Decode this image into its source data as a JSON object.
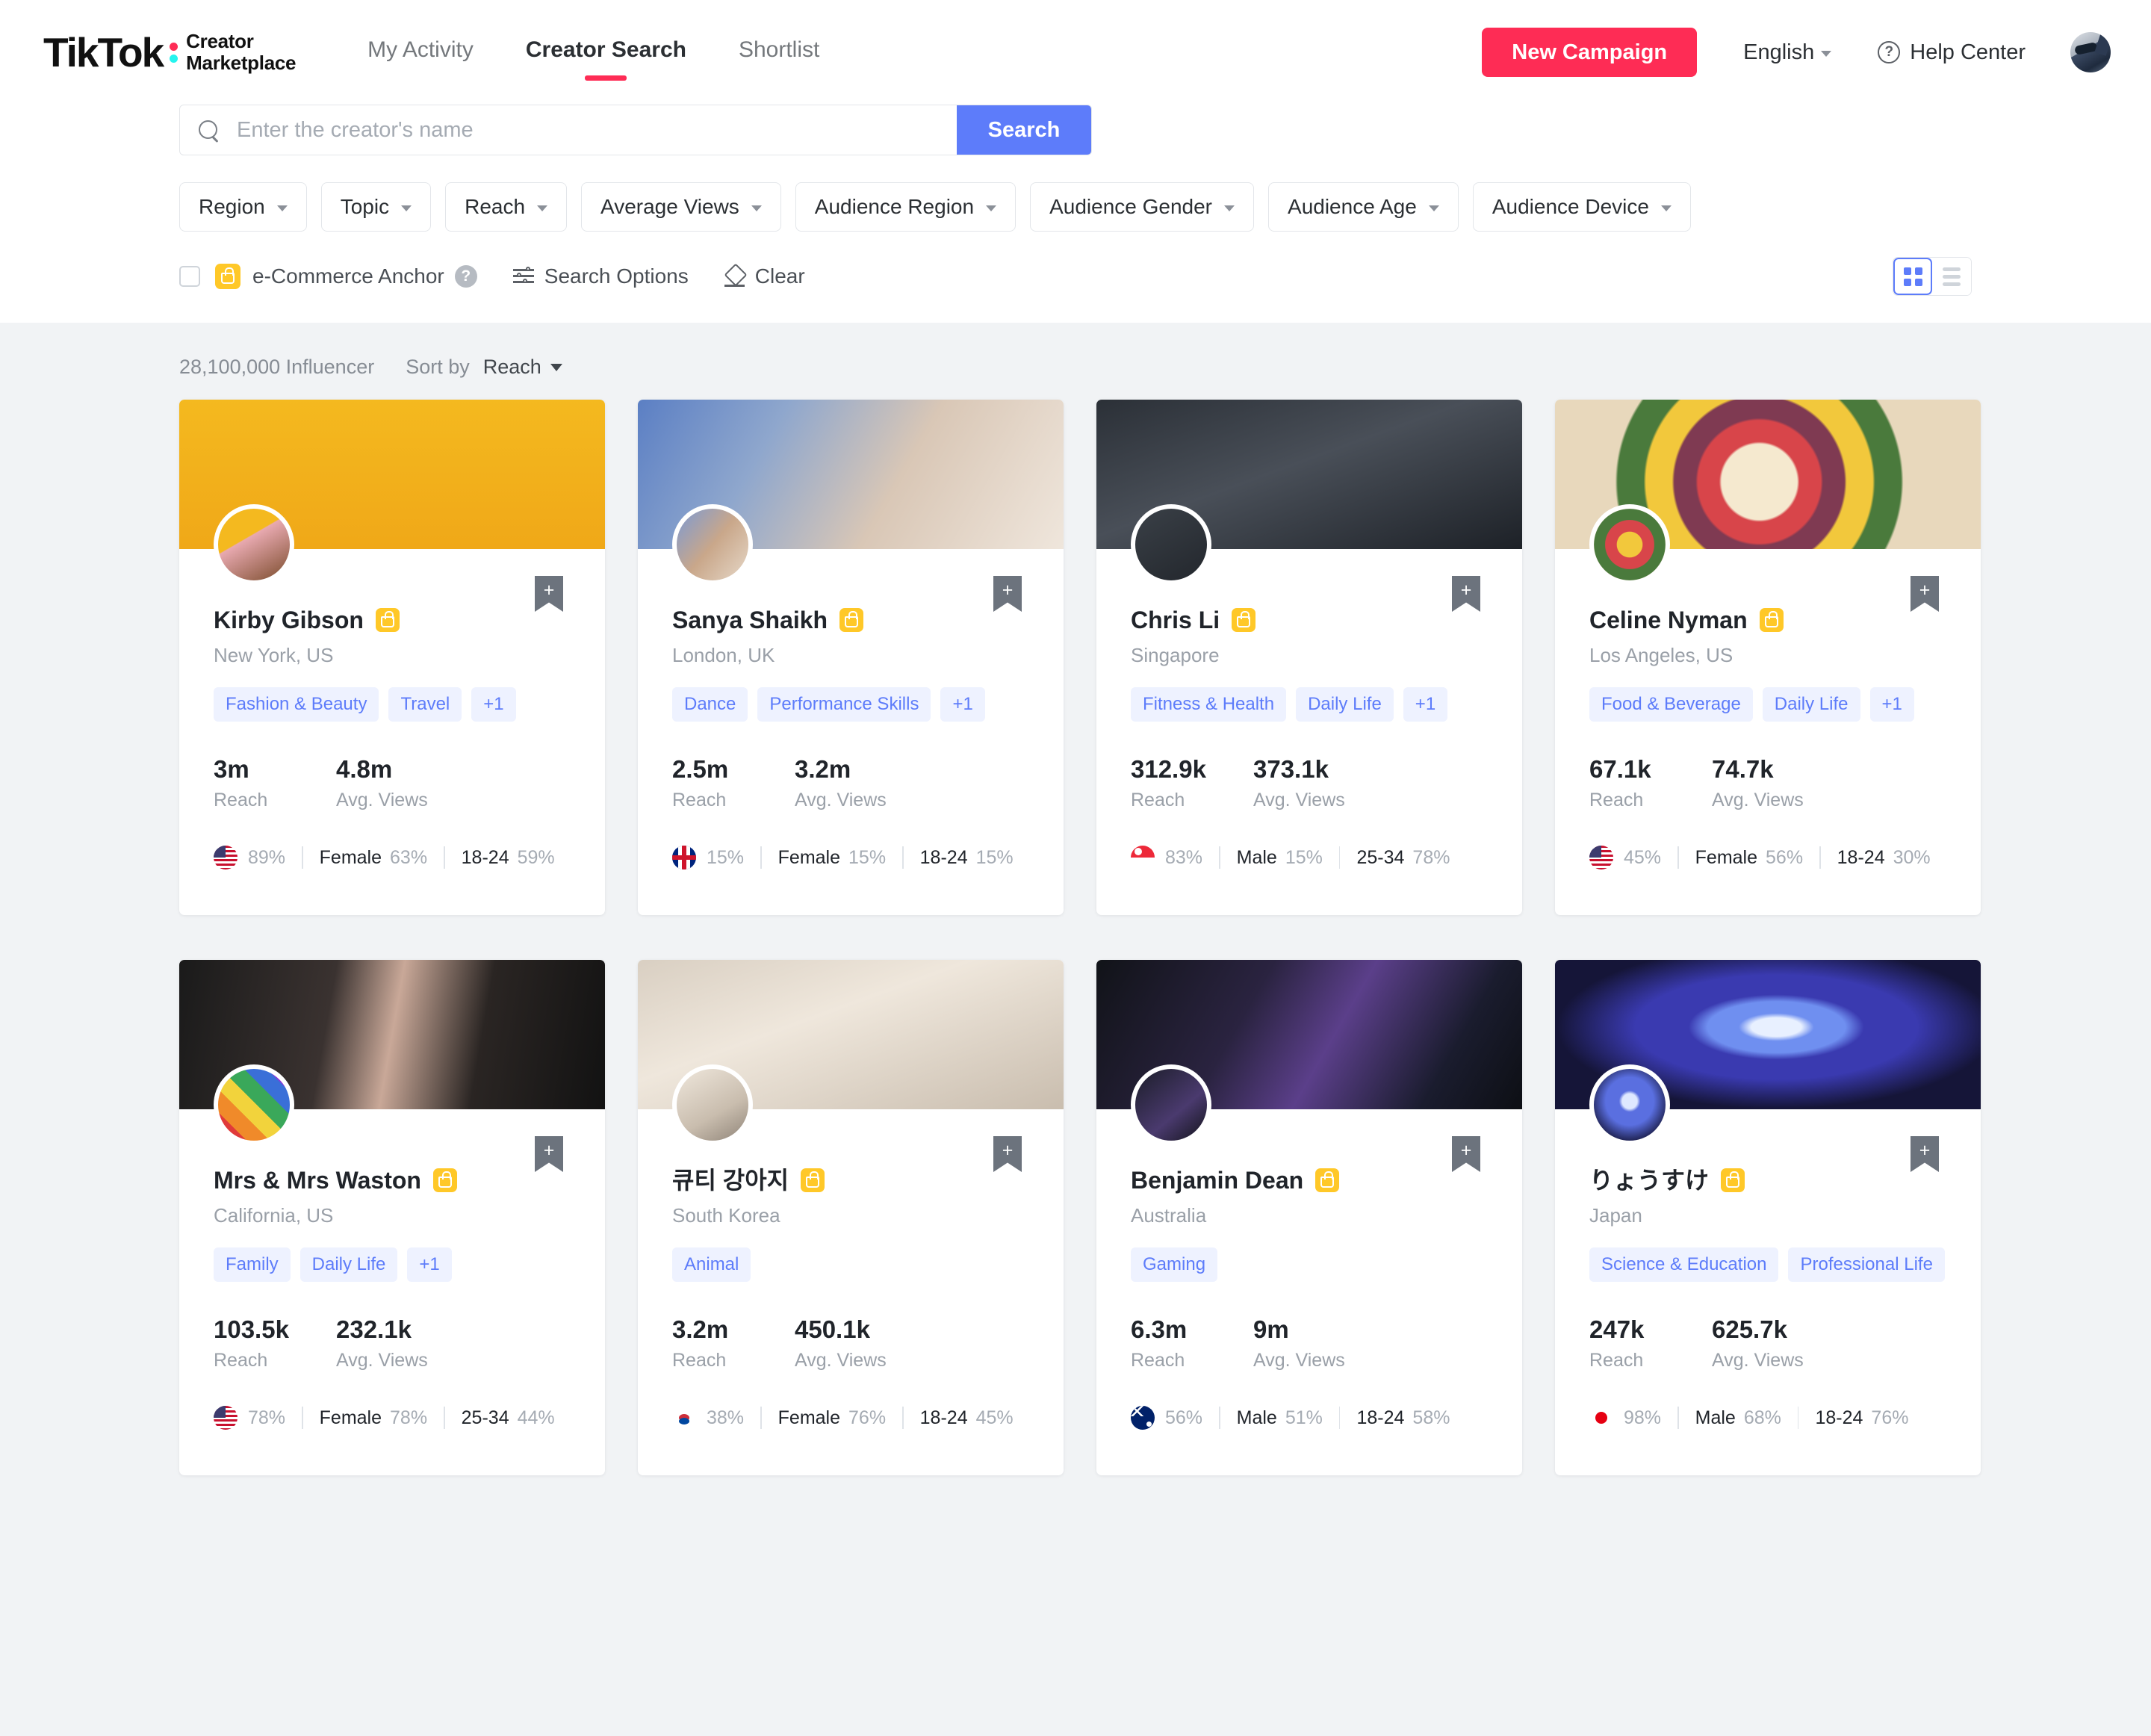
{
  "header": {
    "logo_main": "TikTok",
    "logo_sub_line1": "Creator",
    "logo_sub_line2": "Marketplace",
    "nav": [
      {
        "label": "My Activity",
        "active": false
      },
      {
        "label": "Creator Search",
        "active": true
      },
      {
        "label": "Shortlist",
        "active": false
      }
    ],
    "new_campaign_label": "New Campaign",
    "language_label": "English",
    "help_label": "Help Center",
    "accent_color": "#fe2c55"
  },
  "search": {
    "placeholder": "Enter the creator's name",
    "value": "",
    "button_label": "Search",
    "button_color": "#5d7cfa"
  },
  "filters": [
    {
      "label": "Region"
    },
    {
      "label": "Topic"
    },
    {
      "label": "Reach"
    },
    {
      "label": "Average Views"
    },
    {
      "label": "Audience Region"
    },
    {
      "label": "Audience Gender"
    },
    {
      "label": "Audience Age"
    },
    {
      "label": "Audience Device"
    }
  ],
  "options": {
    "ecommerce_anchor_label": "e-Commerce Anchor",
    "ecommerce_checked": false,
    "search_options_label": "Search Options",
    "clear_label": "Clear",
    "view_grid_active": true,
    "view_list_active": false
  },
  "results": {
    "count_label": "28,100,000 Influencer",
    "sort_by_label": "Sort by",
    "sort_value": "Reach",
    "reach_label": "Reach",
    "avg_views_label": "Avg. Views"
  },
  "creators": [
    {
      "name": "Kirby Gibson",
      "location": "New York, US",
      "tags": [
        "Fashion & Beauty",
        "Travel",
        "+1"
      ],
      "reach": "3m",
      "avg_views": "4.8m",
      "country_flag": "us-flag",
      "country_pct": "89%",
      "gender": "Female",
      "gender_pct": "63%",
      "age": "18-24",
      "age_pct": "59%",
      "cover_css": "linear-gradient(180deg,#f4b91f 0%,#f0a818 100%)",
      "avatar_css": "linear-gradient(150deg,#f4b91f 40%,#e8a9b0 41%,#7a4b2a 100%)"
    },
    {
      "name": "Sanya Shaikh",
      "location": "London, UK",
      "tags": [
        "Dance",
        "Performance Skills",
        "+1"
      ],
      "reach": "2.5m",
      "avg_views": "3.2m",
      "country_flag": "uk-flag",
      "country_pct": "15%",
      "gender": "Female",
      "gender_pct": "15%",
      "age": "18-24",
      "age_pct": "15%",
      "cover_css": "linear-gradient(120deg,#5b7fc4 0%,#8fa7cd 30%,#d9c7b6 60%,#efe6dc 100%)",
      "avatar_css": "linear-gradient(130deg,#7b9ad4 0%,#c9a78a 50%,#e6d8c8 100%)"
    },
    {
      "name": "Chris Li",
      "location": "Singapore",
      "tags": [
        "Fitness & Health",
        "Daily Life",
        "+1"
      ],
      "reach": "312.9k",
      "avg_views": "373.1k",
      "country_flag": "sg-flag",
      "country_pct": "83%",
      "gender": "Male",
      "gender_pct": "15%",
      "age": "25-34",
      "age_pct": "78%",
      "cover_css": "linear-gradient(160deg,#2b3037 0%,#494f58 45%,#1d2127 100%)",
      "avatar_css": "linear-gradient(150deg,#3a4047 0%,#23272d 100%)"
    },
    {
      "name": "Celine Nyman",
      "location": "Los Angeles, US",
      "tags": [
        "Food & Beverage",
        "Daily Life",
        "+1"
      ],
      "reach": "67.1k",
      "avg_views": "74.7k",
      "country_flag": "us-flag",
      "country_pct": "45%",
      "gender": "Female",
      "gender_pct": "56%",
      "age": "18-24",
      "age_pct": "30%",
      "cover_css": "radial-gradient(circle at 48% 55%, #f5e9cf 0 16%, #d8454a 17% 26%, #7f3a52 27% 36%, #f2c83c 37% 48%, #4a7a3c 49% 60%, #e8d8bc 61% 100%)",
      "avatar_css": "radial-gradient(circle at 50% 50%, #f2c83c 0 25%, #d8454a 26% 48%, #4a7a3c 49% 70%, #e8d8bc 71% 100%)"
    },
    {
      "name": "Mrs & Mrs Waston",
      "location": "California, US",
      "tags": [
        "Family",
        "Daily Life",
        "+1"
      ],
      "reach": "103.5k",
      "avg_views": "232.1k",
      "country_flag": "us-flag",
      "country_pct": "78%",
      "gender": "Female",
      "gender_pct": "78%",
      "age": "25-34",
      "age_pct": "44%",
      "cover_css": "linear-gradient(100deg,#1a1a1a 0%,#3a3230 35%,#c9a898 50%,#2a2523 70%,#121212 100%)",
      "avatar_css": "linear-gradient(45deg,#e03a3a 0 20%,#f08a2a 20% 36%,#f2d33c 36% 52%,#3aa85a 52% 68%,#3a6fd8 68% 84%,#8a3ad8 84% 100%)"
    },
    {
      "name": "큐티 강아지",
      "location": "South Korea",
      "tags": [
        "Animal"
      ],
      "reach": "3.2m",
      "avg_views": "450.1k",
      "country_flag": "kr-flag",
      "country_pct": "38%",
      "gender": "Female",
      "gender_pct": "76%",
      "age": "18-24",
      "age_pct": "45%",
      "cover_css": "linear-gradient(160deg,#d9cfc2 0%,#efe7dc 40%,#c9bdae 100%)",
      "avatar_css": "linear-gradient(150deg,#efe7dc 0%,#c9bdae 60%,#8f8478 100%)"
    },
    {
      "name": "Benjamin Dean",
      "location": "Australia",
      "tags": [
        "Gaming"
      ],
      "reach": "6.3m",
      "avg_views": "9m",
      "country_flag": "au-flag",
      "country_pct": "56%",
      "gender": "Male",
      "gender_pct": "51%",
      "age": "18-24",
      "age_pct": "58%",
      "cover_css": "linear-gradient(120deg,#111318 0%,#2a2340 35%,#5b3f8a 55%,#1a1c2e 80%,#0d0f14 100%)",
      "avatar_css": "linear-gradient(140deg,#1b1d28 0%,#4a3a6e 60%,#121319 100%)"
    },
    {
      "name": "りょうすけ",
      "location": "Japan",
      "tags": [
        "Science & Education",
        "Professional Life"
      ],
      "reach": "247k",
      "avg_views": "625.7k",
      "country_flag": "jp-flag",
      "country_pct": "98%",
      "gender": "Male",
      "gender_pct": "68%",
      "age": "18-24",
      "age_pct": "76%",
      "cover_css": "radial-gradient(ellipse at 52% 45%, #e8f0ff 0 8%, #6f8ff0 12% 22%, #3a3ab0 28% 45%, #151538 70% 100%)",
      "avatar_css": "radial-gradient(circle at 50% 45%, #dfe8ff 0 14%, #5a6fe0 20% 45%, #15153a 80% 100%)"
    }
  ]
}
